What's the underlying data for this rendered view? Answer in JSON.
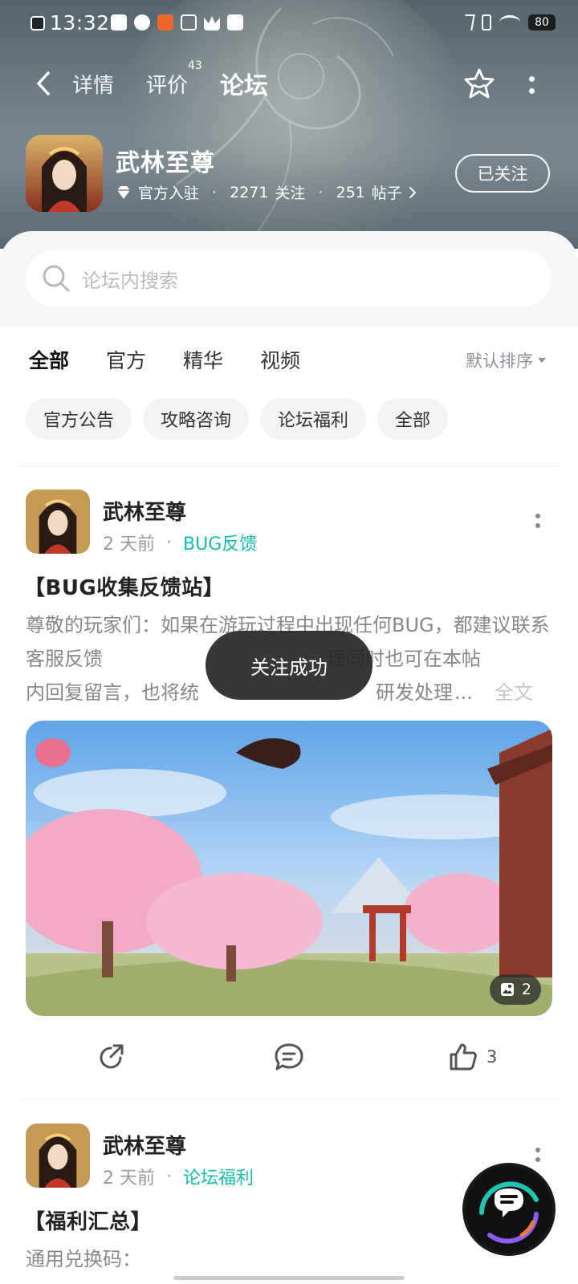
{
  "status_bar": {
    "time": "13:32",
    "battery": "80"
  },
  "top_nav": {
    "tabs": [
      {
        "label": "详情"
      },
      {
        "label": "评价"
      },
      {
        "label": "论坛"
      }
    ],
    "review_count": "43",
    "active_tab": "论坛"
  },
  "game": {
    "title": "武林至尊",
    "badge": "官方入驻",
    "followers": "2271",
    "followers_label": "关注",
    "posts": "251",
    "posts_label": "帖子",
    "follow_button": "已关注",
    "meta_sep": "·"
  },
  "search": {
    "placeholder": "论坛内搜索"
  },
  "filter_tabs": {
    "tabs": [
      "全部",
      "官方",
      "精华",
      "视频"
    ],
    "active": "全部",
    "sort_label": "默认排序"
  },
  "chips": [
    "官方公告",
    "攻略咨询",
    "论坛福利",
    "全部"
  ],
  "posts": [
    {
      "author": "武林至尊",
      "time": "2 天前",
      "tag": "BUG反馈",
      "title": "【BUG收集反馈站】",
      "body": "尊敬的玩家们：如果在游玩过程中出现任何BUG，都建议联系客服反馈",
      "body_2": "理同时也可在本帖",
      "body_3": "内回复留言，也将统",
      "body_4": "研发处理",
      "ellipsis": "...",
      "full_text_label": "全文",
      "image_count": "2",
      "like_count": "3"
    },
    {
      "author": "武林至尊",
      "time": "2 天前",
      "tag": "论坛福利",
      "title": "【福利汇总】",
      "body": "通用兑换码："
    }
  ],
  "toast": "关注成功",
  "colors": {
    "accent": "#14c4b4",
    "tag": "#13bfae",
    "toast_bg": "#262626"
  },
  "icons": {
    "back": "chevron-left-icon",
    "favorite": "star-smile-icon",
    "more": "more-vertical-icon",
    "search": "search-icon",
    "share": "share-icon",
    "comment": "comment-icon",
    "like": "thumbs-up-icon",
    "image": "image-icon",
    "chat": "chat-bubble-icon",
    "diamond": "diamond-icon"
  }
}
